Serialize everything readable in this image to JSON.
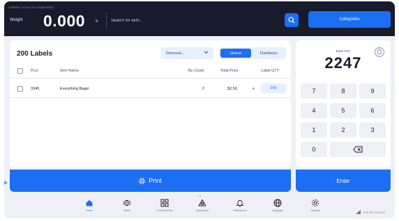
{
  "topbar": {
    "status_text": "CURRENT SCALE ON   123456   ZERO",
    "weight_label": "Weight",
    "weight_value": "0.000",
    "weight_unit": "lb",
    "search_placeholder": "Search for item...",
    "categories_label": "Categories"
  },
  "labels_panel": {
    "title": "200 Labels",
    "sort_value": "Removal...",
    "segments": {
      "queue": "Queue",
      "flashkeys": "Flashkeys"
    },
    "columns": {
      "plu": "PLU",
      "item_name": "Item Name",
      "by_count": "By Count",
      "total_price": "Total Price",
      "label_qty": "Label QTY"
    },
    "rows": [
      {
        "plu": "3345",
        "item_name": "Everything Bagel",
        "by_count": "2",
        "total_price": "$2.50",
        "x": "x",
        "label_qty": "200"
      }
    ],
    "print_label": "Print"
  },
  "keypad": {
    "plu_label": "Enter PLU",
    "plu_value": "2247",
    "keys": [
      "7",
      "8",
      "9",
      "4",
      "5",
      "6",
      "1",
      "2",
      "3",
      "0"
    ],
    "enter_label": "Enter"
  },
  "bottom_nav": {
    "items": [
      {
        "label": "Home",
        "icon": "home-icon"
      },
      {
        "label": "Tables",
        "icon": "scale-icon"
      },
      {
        "label": "Products Entry",
        "icon": "grid-icon"
      },
      {
        "label": "Department",
        "icon": "department-icon"
      },
      {
        "label": "Notifications",
        "icon": "bell-icon"
      },
      {
        "label": "Language",
        "icon": "globe-icon"
      },
      {
        "label": "Settings",
        "icon": "gear-icon"
      }
    ],
    "clock": "12:41 PM   Jul 9 2024"
  },
  "colors": {
    "accent": "#1c6ef2",
    "topbar": "#171b2c",
    "background": "#eef0f6"
  }
}
